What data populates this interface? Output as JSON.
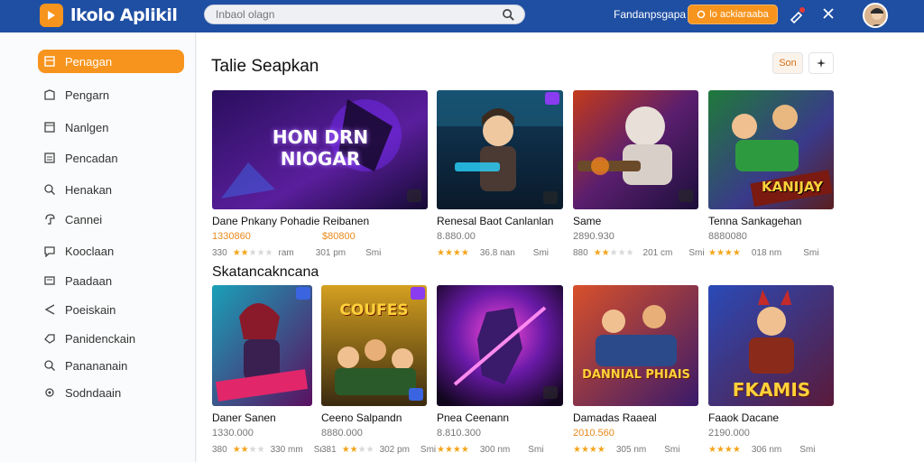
{
  "header": {
    "app_name": "lkolo Aplikil",
    "search_placeholder": "Inbaol olagn",
    "link_label": "Fandanpsgapa",
    "cta_label": "lo ackiaraaba"
  },
  "sidebar": {
    "items": [
      {
        "label": "Penagan",
        "icon": "square-icon",
        "active": true
      },
      {
        "label": "Pengarn",
        "icon": "home-icon"
      },
      {
        "label": "Nanlgen",
        "icon": "document-icon"
      },
      {
        "label": "Pencadan",
        "icon": "list-icon"
      },
      {
        "label": "Henakan",
        "icon": "search-icon"
      },
      {
        "label": "Cannei",
        "icon": "compass-icon"
      },
      {
        "label": "Kooclaan",
        "icon": "chat-icon"
      },
      {
        "label": "Paadaan",
        "icon": "message-icon"
      },
      {
        "label": "Poeiskain",
        "icon": "share-icon"
      },
      {
        "label": "Panidenckain",
        "icon": "tag-icon"
      },
      {
        "label": "Panananain",
        "icon": "search-icon"
      },
      {
        "label": "Sodndaain",
        "icon": "settings-icon"
      }
    ]
  },
  "main": {
    "section1_title": "Talie Seapkan",
    "sort_label": "Son",
    "section2_title": "Skatancakncana",
    "row1": [
      {
        "title": "Dane Pnkany Pohadie Reibanen",
        "price": "1330860",
        "price2": "$80800",
        "meta": "330",
        "meta2": "ram",
        "meta3": "301 pm",
        "meta4": "Smi",
        "rating": 2,
        "thumb_text": "HON DRN NIOGAR"
      },
      {
        "title": "Renesal Baot Canlanlan",
        "price": "8.880.00",
        "meta": "36.8 nan",
        "meta2": "Smi",
        "rating": 4,
        "thumb_text": ""
      },
      {
        "title": "Same",
        "price": "2890.930",
        "meta": "880",
        "meta2": "201 cm",
        "meta3": "Smi",
        "rating": 2,
        "thumb_text": ""
      },
      {
        "title": "Tenna Sankagehan",
        "price": "8880080",
        "meta": "018 nm",
        "meta2": "Smi",
        "rating": 4,
        "thumb_text": "KANIJAY"
      }
    ],
    "row2": [
      {
        "title": "Daner Sanen",
        "price": "1330.000",
        "meta": "380",
        "meta2": "330 mm",
        "meta3": "Smi",
        "rating": 2,
        "thumb_text": ""
      },
      {
        "title": "Ceeno Salpandn",
        "price": "8880.000",
        "meta": "381",
        "meta2": "302 pm",
        "meta3": "Smi",
        "rating": 2,
        "thumb_text": "COUFES"
      },
      {
        "title": "Pnea Ceenann",
        "price": "8.810.300",
        "meta": "300 nm",
        "meta2": "Smi",
        "rating": 4,
        "thumb_text": ""
      },
      {
        "title": "Damadas Raaeal",
        "price": "2010.560",
        "meta": "305 nm",
        "meta2": "Smi",
        "rating": 4,
        "thumb_text": "DANNIAL PHIAIS"
      },
      {
        "title": "Faaok Dacane",
        "price": "2190.000",
        "meta": "306 nm",
        "meta2": "Smi",
        "rating": 4,
        "thumb_text": "FKAMIS"
      }
    ]
  },
  "colors": {
    "accent": "#f7941d",
    "header": "#1f4fa3"
  }
}
